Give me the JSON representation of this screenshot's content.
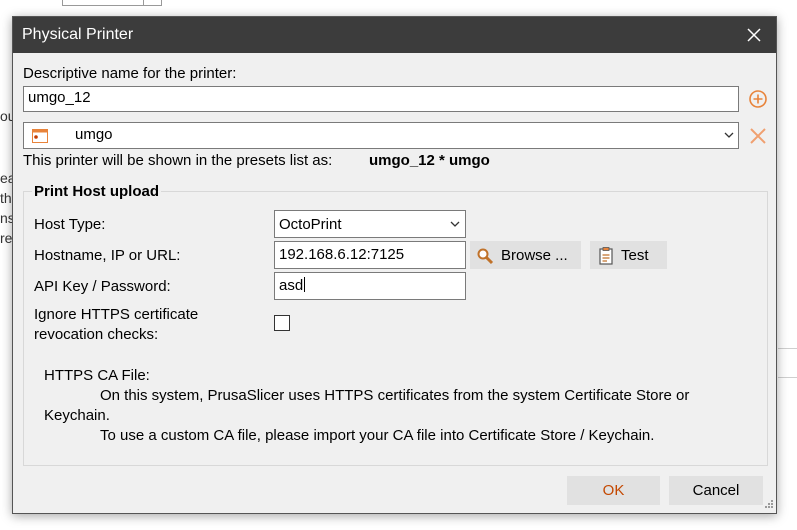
{
  "background": {
    "fragments": [
      "ou",
      "ea",
      "th",
      "ns",
      "re"
    ]
  },
  "dialog": {
    "title": "Physical Printer",
    "descriptive_name_label": "Descriptive name for the printer:",
    "printer_name": "umgo_12",
    "preset_name": "umgo",
    "presets_info": "This printer will be shown in the presets list as:",
    "presets_display": "umgo_12 * umgo",
    "group_title": "Print Host upload",
    "host_type_label": "Host Type:",
    "host_type_value": "OctoPrint",
    "hostname_label": "Hostname, IP or URL:",
    "hostname_value": "192.168.6.12:7125",
    "browse_label": "Browse ...",
    "test_label": "Test",
    "api_key_label": "API Key / Password:",
    "api_key_value": "asd",
    "ignore_https_label_1": "Ignore HTTPS certificate",
    "ignore_https_label_2": "revocation checks:",
    "ignore_https_checked": false,
    "ca_title": "HTTPS CA File:",
    "ca_line1": "On this system, PrusaSlicer uses HTTPS certificates from the system Certificate Store or",
    "ca_line2": "Keychain.",
    "ca_line3": "To use a custom CA file, please import your CA file into Certificate Store / Keychain.",
    "ok_label": "OK",
    "cancel_label": "Cancel"
  },
  "colors": {
    "titlebar": "#3c3c3c",
    "accent": "#e8833a",
    "ok_text": "#c44800"
  }
}
